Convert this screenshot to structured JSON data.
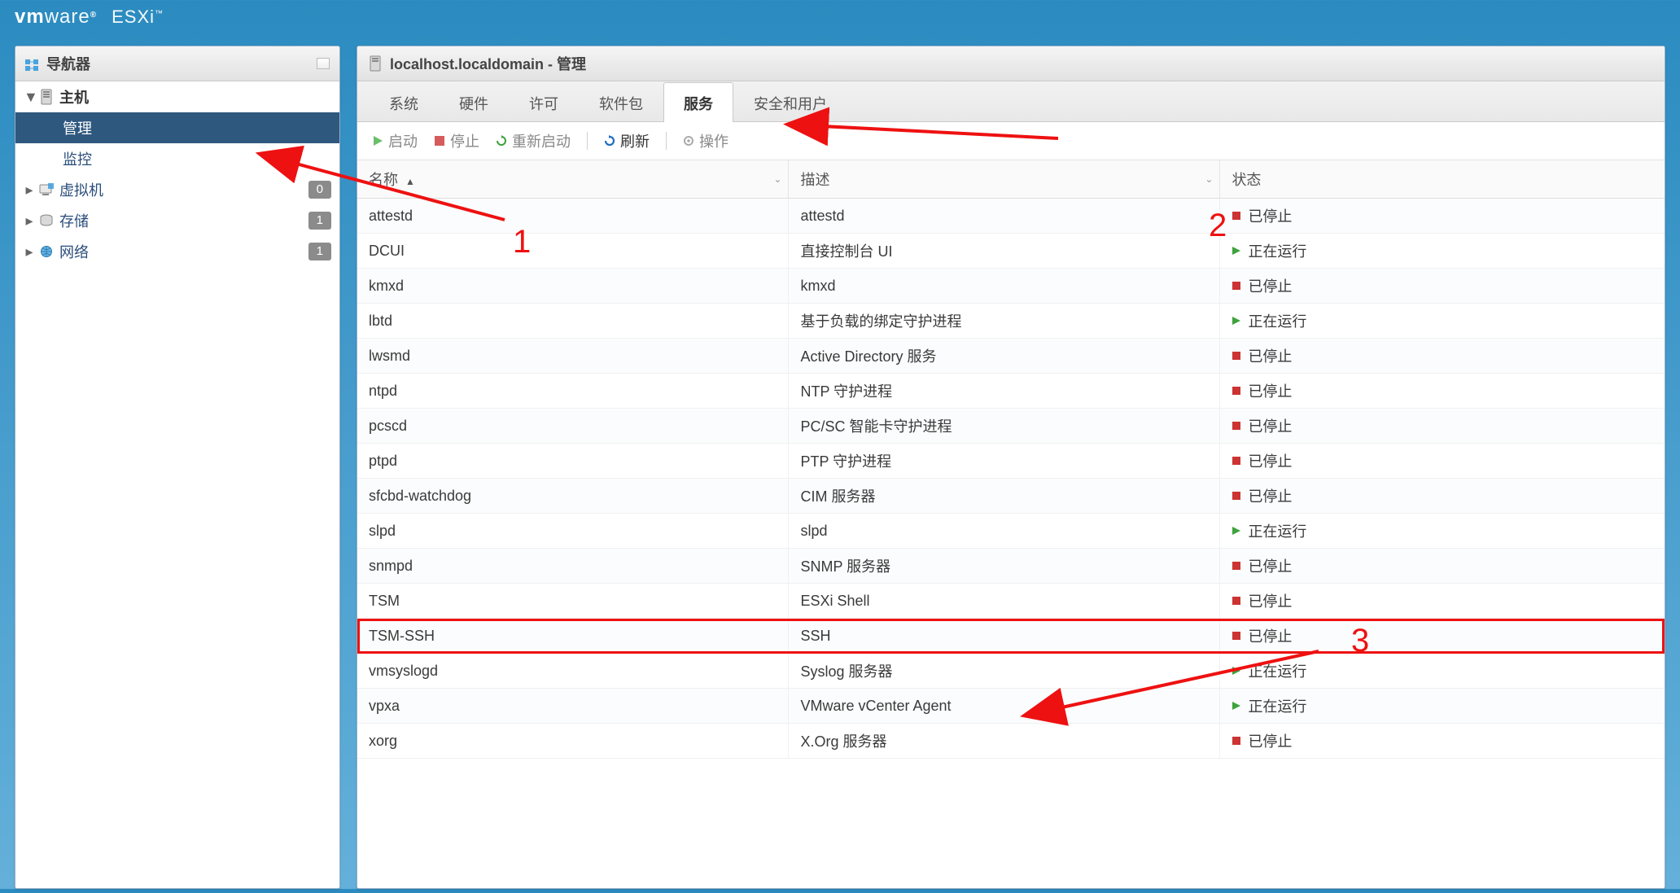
{
  "brand": {
    "vm": "vm",
    "ware": "ware",
    "reg": "®",
    "esxi": "ESXi",
    "tm": "™"
  },
  "navigator": {
    "title": "导航器",
    "host_label": "主机",
    "items": [
      {
        "label": "管理",
        "active": true
      },
      {
        "label": "监控",
        "active": false
      }
    ],
    "groups": [
      {
        "label": "虚拟机",
        "count": "0",
        "icon": "vm"
      },
      {
        "label": "存储",
        "count": "1",
        "icon": "storage"
      },
      {
        "label": "网络",
        "count": "1",
        "icon": "network"
      }
    ]
  },
  "content": {
    "title": "localhost.localdomain - 管理",
    "tabs": [
      "系统",
      "硬件",
      "许可",
      "软件包",
      "服务",
      "安全和用户"
    ],
    "active_tab_index": 4,
    "toolbar": {
      "start": "启动",
      "stop": "停止",
      "restart": "重新启动",
      "refresh": "刷新",
      "actions": "操作"
    },
    "columns": {
      "name": "名称",
      "desc": "描述",
      "state": "状态"
    },
    "states": {
      "running": "正在运行",
      "stopped": "已停止"
    },
    "services": [
      {
        "name": "attestd",
        "desc": "attestd",
        "running": false
      },
      {
        "name": "DCUI",
        "desc": "直接控制台 UI",
        "running": true
      },
      {
        "name": "kmxd",
        "desc": "kmxd",
        "running": false
      },
      {
        "name": "lbtd",
        "desc": "基于负载的绑定守护进程",
        "running": true
      },
      {
        "name": "lwsmd",
        "desc": "Active Directory 服务",
        "running": false
      },
      {
        "name": "ntpd",
        "desc": "NTP 守护进程",
        "running": false
      },
      {
        "name": "pcscd",
        "desc": "PC/SC 智能卡守护进程",
        "running": false
      },
      {
        "name": "ptpd",
        "desc": "PTP 守护进程",
        "running": false
      },
      {
        "name": "sfcbd-watchdog",
        "desc": "CIM 服务器",
        "running": false
      },
      {
        "name": "slpd",
        "desc": "slpd",
        "running": true
      },
      {
        "name": "snmpd",
        "desc": "SNMP 服务器",
        "running": false
      },
      {
        "name": "TSM",
        "desc": "ESXi Shell",
        "running": false
      },
      {
        "name": "TSM-SSH",
        "desc": "SSH",
        "running": false,
        "highlight": true
      },
      {
        "name": "vmsyslogd",
        "desc": "Syslog 服务器",
        "running": true
      },
      {
        "name": "vpxa",
        "desc": "VMware vCenter Agent",
        "running": true
      },
      {
        "name": "xorg",
        "desc": "X.Org 服务器",
        "running": false
      }
    ]
  },
  "annotations": {
    "n1": "1",
    "n2": "2",
    "n3": "3"
  }
}
